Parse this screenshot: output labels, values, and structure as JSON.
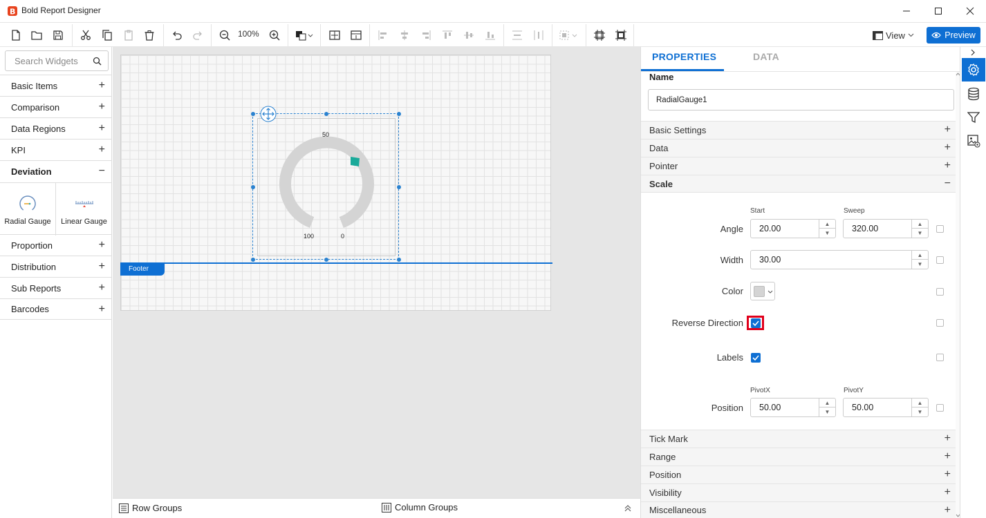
{
  "window": {
    "title": "Bold Report Designer"
  },
  "toolbar": {
    "zoom": "100%",
    "view_label": "View",
    "preview_label": "Preview"
  },
  "sidebar": {
    "search_placeholder": "Search Widgets",
    "categories": [
      {
        "label": "Basic Items",
        "state": "+"
      },
      {
        "label": "Comparison",
        "state": "+"
      },
      {
        "label": "Data Regions",
        "state": "+"
      },
      {
        "label": "KPI",
        "state": "+"
      },
      {
        "label": "Deviation",
        "state": "−"
      },
      {
        "label": "Proportion",
        "state": "+"
      },
      {
        "label": "Distribution",
        "state": "+"
      },
      {
        "label": "Sub Reports",
        "state": "+"
      },
      {
        "label": "Barcodes",
        "state": "+"
      }
    ],
    "widgets": [
      "Radial Gauge",
      "Linear Gauge"
    ]
  },
  "canvas": {
    "gauge_labels": {
      "top": "50",
      "left": "100",
      "right": "0"
    },
    "footer_label": "Footer"
  },
  "bottom": {
    "row_groups": "Row Groups",
    "column_groups": "Column Groups"
  },
  "properties": {
    "tabs": [
      "PROPERTIES",
      "DATA"
    ],
    "name_label": "Name",
    "name_value": "RadialGauge1",
    "sections_top": [
      {
        "label": "Basic Settings",
        "state": "+"
      },
      {
        "label": "Data",
        "state": "+"
      },
      {
        "label": "Pointer",
        "state": "+"
      },
      {
        "label": "Scale",
        "state": "−"
      }
    ],
    "scale": {
      "start_label": "Start",
      "sweep_label": "Sweep",
      "angle_label": "Angle",
      "start_value": "20.00",
      "sweep_value": "320.00",
      "width_label": "Width",
      "width_value": "30.00",
      "color_label": "Color",
      "reverse_label": "Reverse Direction",
      "labels_label": "Labels",
      "pivotx_label": "PivotX",
      "pivoty_label": "PivotY",
      "position_label": "Position",
      "pivotx_value": "50.00",
      "pivoty_value": "50.00"
    },
    "sections_bottom": [
      {
        "label": "Tick Mark",
        "state": "+"
      },
      {
        "label": "Range",
        "state": "+"
      },
      {
        "label": "Position",
        "state": "+"
      },
      {
        "label": "Visibility",
        "state": "+"
      },
      {
        "label": "Miscellaneous",
        "state": "+"
      }
    ]
  },
  "colors": {
    "accent": "#0e6fd3",
    "highlight": "#e0001b",
    "gauge_track": "#d4d4d4",
    "gauge_pointer": "#1aaa9a"
  }
}
